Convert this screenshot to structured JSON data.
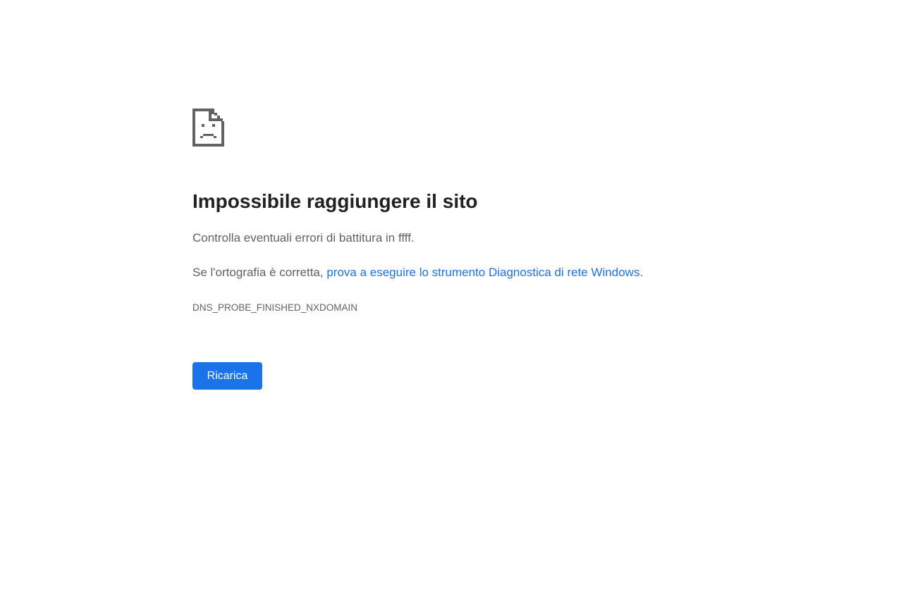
{
  "icon": "sad-page-icon",
  "colors": {
    "heading": "#202124",
    "body_text": "#5f6368",
    "link": "#1a73e8",
    "button_bg": "#1a73e8",
    "button_text": "#ffffff",
    "icon": "#5f6368"
  },
  "error": {
    "title": "Impossibile raggiungere il sito",
    "check_message": "Controlla eventuali errori di battitura in ffff.",
    "suggestion_prefix": "Se l'ortografia è corretta, ",
    "suggestion_link": "prova a eseguire lo strumento Diagnostica di rete Windows",
    "suggestion_suffix": ".",
    "code": "DNS_PROBE_FINISHED_NXDOMAIN"
  },
  "actions": {
    "reload_label": "Ricarica"
  }
}
